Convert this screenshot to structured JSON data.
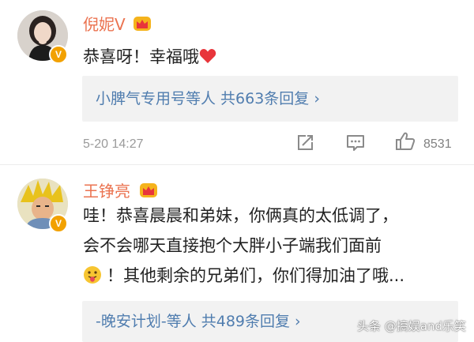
{
  "comments": [
    {
      "username": "倪妮V",
      "text_lines": [
        "恭喜呀！幸福哦"
      ],
      "reply_summary": "小脾气专用号等人 共663条回复 ›",
      "timestamp": "5-20 14:27",
      "likes": "8531"
    },
    {
      "username": "王铮亮",
      "text_lines": [
        "哇！恭喜晨晨和弟妹，你俩真的太低调了，",
        "会不会哪天直接抱个大胖小子端我们面前",
        "！其他剩余的兄弟们，你们得加油了哦..."
      ],
      "reply_summary": "-晚安计划-等人 共489条回复 ›"
    }
  ],
  "watermark": "头条 @搞娱and乐笑",
  "icons": [
    "verified-v-badge-icon",
    "crown-member-icon",
    "repost-icon",
    "comment-icon",
    "like-thumb-icon",
    "red-heart-emoji-icon",
    "tongue-face-emoji-icon"
  ],
  "colors": {
    "username": "#eb7350",
    "link": "#507daf",
    "meta": "#9a9a9a",
    "reply_bg": "#f2f2f2",
    "badge": "#f2a100",
    "heart": "#e8353b"
  }
}
